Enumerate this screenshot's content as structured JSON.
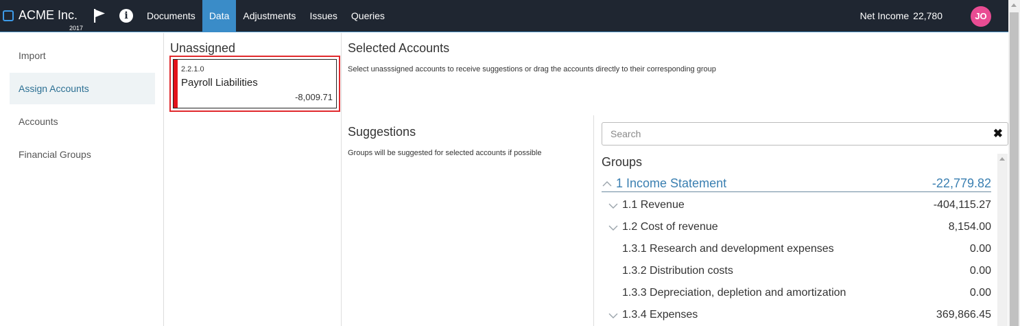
{
  "app": {
    "name": "ACME Inc.",
    "year": "2017",
    "nav": [
      "Documents",
      "Data",
      "Adjustments",
      "Issues",
      "Queries"
    ],
    "active_nav": "Data",
    "net_income_label": "Net Income",
    "net_income_value": "22,780",
    "avatar_initials": "JO"
  },
  "sidebar": {
    "items": [
      {
        "label": "Import",
        "active": false
      },
      {
        "label": "Assign Accounts",
        "active": true
      },
      {
        "label": "Accounts",
        "active": false
      },
      {
        "label": "Financial Groups",
        "active": false
      }
    ]
  },
  "unassigned": {
    "title": "Unassigned",
    "accounts": [
      {
        "code": "2.2.1.0",
        "name": "Payroll Liabilities",
        "amount": "-8,009.71"
      }
    ]
  },
  "selected": {
    "title": "Selected Accounts",
    "hint": "Select unasssigned accounts to receive suggestions or drag the accounts directly to their corresponding group"
  },
  "suggestions": {
    "title": "Suggestions",
    "hint": "Groups will be suggested for selected accounts if possible"
  },
  "groups": {
    "search_placeholder": "Search",
    "title": "Groups",
    "rows": [
      {
        "name": "1 Income Statement",
        "value": "-22,779.82",
        "level": 0,
        "expandable": true
      },
      {
        "name": "1.1 Revenue",
        "value": "-404,115.27",
        "level": 1,
        "expandable": true
      },
      {
        "name": "1.2 Cost of revenue",
        "value": "8,154.00",
        "level": 1,
        "expandable": true
      },
      {
        "name": "1.3.1 Research and development expenses",
        "value": "0.00",
        "level": 1,
        "expandable": false
      },
      {
        "name": "1.3.2 Distribution costs",
        "value": "0.00",
        "level": 1,
        "expandable": false
      },
      {
        "name": "1.3.3 Depreciation, depletion and amortization",
        "value": "0.00",
        "level": 1,
        "expandable": false
      },
      {
        "name": "1.3.4 Expenses",
        "value": "369,866.45",
        "level": 1,
        "expandable": true
      }
    ]
  },
  "colors": {
    "topbar": "#1f2631",
    "active_tab": "#3a8cc8",
    "avatar": "#e94c93",
    "selected_border": "#e0282c",
    "group_link": "#3a7fb1"
  }
}
